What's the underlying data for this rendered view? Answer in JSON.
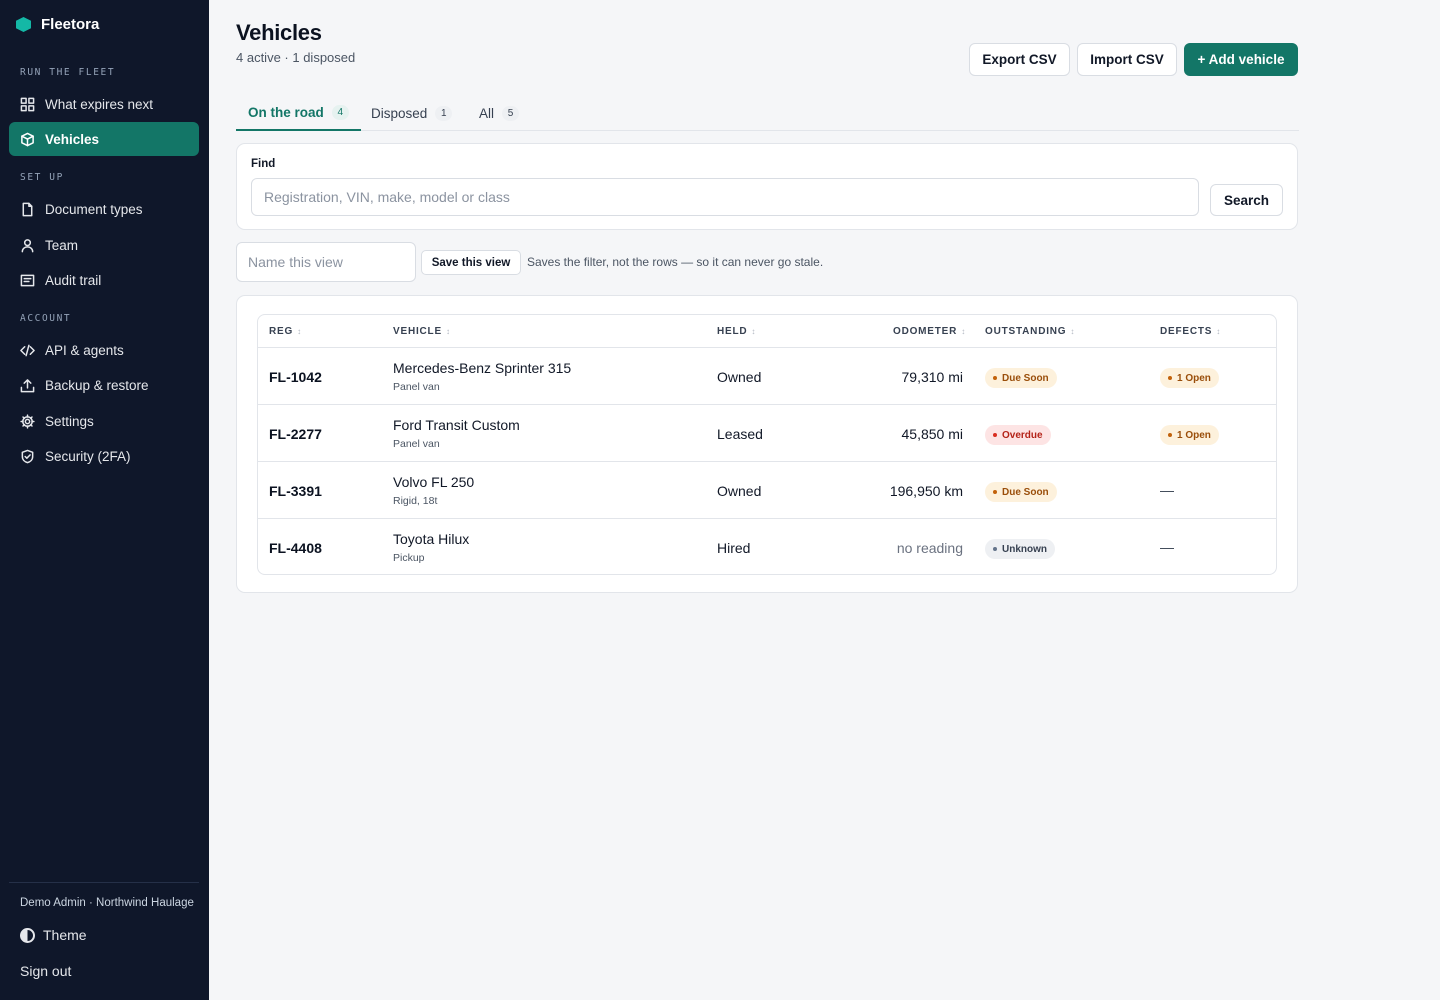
{
  "app": {
    "name": "Fleetora"
  },
  "sidebar": {
    "sections": [
      {
        "label": "RUN THE FLEET",
        "items": [
          {
            "label": "What expires next",
            "icon": "grid-icon"
          },
          {
            "label": "Vehicles",
            "icon": "box-icon",
            "active": true
          }
        ]
      },
      {
        "label": "SET UP",
        "items": [
          {
            "label": "Document types",
            "icon": "file-icon"
          },
          {
            "label": "Team",
            "icon": "user-icon"
          },
          {
            "label": "Audit trail",
            "icon": "list-icon"
          }
        ]
      },
      {
        "label": "ACCOUNT",
        "items": [
          {
            "label": "API & agents",
            "icon": "code-icon"
          },
          {
            "label": "Backup & restore",
            "icon": "upload-icon"
          },
          {
            "label": "Settings",
            "icon": "gear-icon"
          },
          {
            "label": "Security (2FA)",
            "icon": "shield-icon"
          }
        ]
      }
    ],
    "user": "Demo Admin · Northwind Haulage",
    "theme_label": "Theme",
    "signout_label": "Sign out"
  },
  "header": {
    "title": "Vehicles",
    "subtitle": "4 active · 1 disposed",
    "export_label": "Export CSV",
    "import_label": "Import CSV",
    "add_label": "+ Add vehicle"
  },
  "tabs": [
    {
      "label": "On the road",
      "count": "4",
      "active": true
    },
    {
      "label": "Disposed",
      "count": "1"
    },
    {
      "label": "All",
      "count": "5"
    }
  ],
  "find": {
    "label": "Find",
    "placeholder": "Registration, VIN, make, model or class",
    "value": "",
    "search_label": "Search"
  },
  "saved_view": {
    "placeholder": "Name this view",
    "save_label": "Save this view",
    "hint": "Saves the filter, not the rows — so it can never go stale."
  },
  "table": {
    "columns": [
      "REG",
      "VEHICLE",
      "HELD",
      "ODOMETER",
      "OUTSTANDING",
      "DEFECTS"
    ],
    "rows": [
      {
        "reg": "FL-1042",
        "vehicle": "Mercedes-Benz Sprinter 315",
        "class": "Panel van",
        "held": "Owned",
        "odometer": "79,310 mi",
        "outstanding": "Due Soon",
        "outstanding_status": "warn",
        "defects": "1 Open"
      },
      {
        "reg": "FL-2277",
        "vehicle": "Ford Transit Custom",
        "class": "Panel van",
        "held": "Leased",
        "odometer": "45,850 mi",
        "outstanding": "Overdue",
        "outstanding_status": "danger",
        "defects": "1 Open"
      },
      {
        "reg": "FL-3391",
        "vehicle": "Volvo FL 250",
        "class": "Rigid, 18t",
        "held": "Owned",
        "odometer": "196,950 km",
        "outstanding": "Due Soon",
        "outstanding_status": "warn",
        "defects": "—"
      },
      {
        "reg": "FL-4408",
        "vehicle": "Toyota Hilux",
        "class": "Pickup",
        "held": "Hired",
        "odometer": "no reading",
        "outstanding": "Unknown",
        "outstanding_status": "neutral",
        "defects": "—"
      }
    ]
  },
  "colors": {
    "accent": "#137667",
    "sidebar_bg": "#0f172a",
    "warn": "#9a4e0a",
    "danger": "#b42318"
  }
}
